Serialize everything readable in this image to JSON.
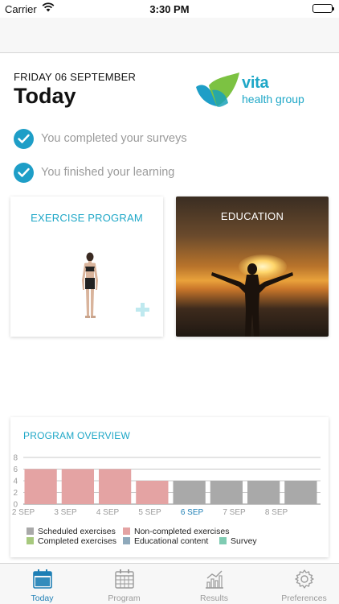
{
  "status_bar": {
    "carrier": "Carrier",
    "time": "3:30 PM",
    "icons": [
      "wifi-icon",
      "battery-icon"
    ]
  },
  "header": {
    "date": "FRIDAY 06 SEPTEMBER",
    "title": "Today",
    "logo": {
      "word": "vita",
      "sub": "health group",
      "color": "#1ea7c7"
    }
  },
  "completed": [
    {
      "text": "You completed your surveys",
      "icon": "check-circle-icon"
    },
    {
      "text": "You finished your learning",
      "icon": "check-circle-icon"
    }
  ],
  "cards": {
    "exercise": {
      "title": "EXERCISE PROGRAM",
      "icon": "plus-icon"
    },
    "education": {
      "title": "EDUCATION"
    }
  },
  "overview": {
    "title": "PROGRAM OVERVIEW",
    "legend": [
      {
        "label": "Scheduled exercises",
        "color": "#a9a9a9"
      },
      {
        "label": "Non-completed exercises",
        "color": "#e4a3a3"
      },
      {
        "label": "Completed exercises",
        "color": "#a7c97e"
      },
      {
        "label": "Educational content",
        "color": "#8fa9bb"
      },
      {
        "label": "Survey",
        "color": "#7fcbb2"
      }
    ]
  },
  "chart_data": {
    "type": "bar",
    "title": "PROGRAM OVERVIEW",
    "categories": [
      "2 SEP",
      "3 SEP",
      "4 SEP",
      "5 SEP",
      "6 SEP",
      "7 SEP",
      "8 SEP"
    ],
    "highlighted_category": "6 SEP",
    "ylim": [
      0,
      8
    ],
    "yticks": [
      "0",
      "2",
      "4",
      "6",
      "8"
    ],
    "grid": true,
    "series": [
      {
        "name": "Non-completed exercises",
        "color": "#e4a3a3",
        "values": [
          6,
          6,
          6,
          4,
          0,
          0,
          0,
          0
        ]
      },
      {
        "name": "Scheduled exercises",
        "color": "#a9a9a9",
        "values": [
          0,
          0,
          0,
          0,
          4,
          4,
          4,
          4
        ]
      }
    ],
    "legend_position": "bottom"
  },
  "tabs": [
    {
      "label": "Today",
      "icon": "calendar-today-icon",
      "active": true
    },
    {
      "label": "Program",
      "icon": "calendar-grid-icon",
      "active": false
    },
    {
      "label": "Results",
      "icon": "bar-chart-icon",
      "active": false
    },
    {
      "label": "Preferences",
      "icon": "gear-icon",
      "active": false
    }
  ],
  "colors": {
    "accent": "#1ea7c7",
    "check": "#1e9ec7",
    "active_tab": "#1e7fb5",
    "muted_text": "#9b9b9b"
  }
}
